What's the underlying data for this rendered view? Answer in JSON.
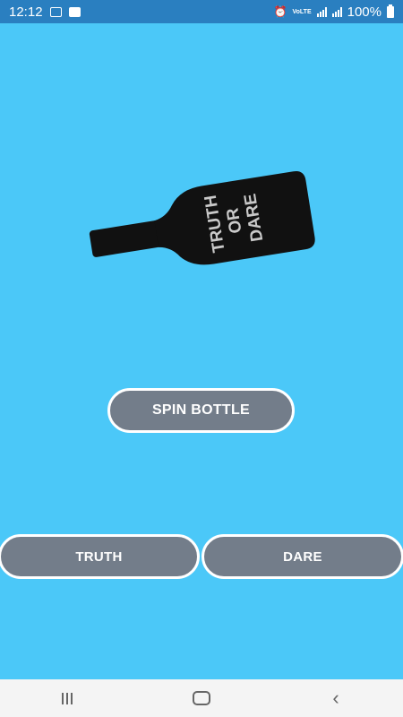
{
  "status_bar": {
    "time": "12:12",
    "battery": "100%",
    "network_label": "VoLTE"
  },
  "bottle": {
    "label_line1": "TRUTH",
    "label_line2": "OR",
    "label_line3": "DARE"
  },
  "buttons": {
    "spin": "SPIN BOTTLE",
    "truth": "TRUTH",
    "dare": "DARE"
  },
  "colors": {
    "background": "#4bc8f8",
    "status_bar": "#2a7fc0",
    "button_fill": "#737d8a",
    "button_border": "#ffffff",
    "bottle": "#111111"
  },
  "nav_bar": {
    "recents": "recents-icon",
    "home": "home-icon",
    "back": "back-icon"
  }
}
